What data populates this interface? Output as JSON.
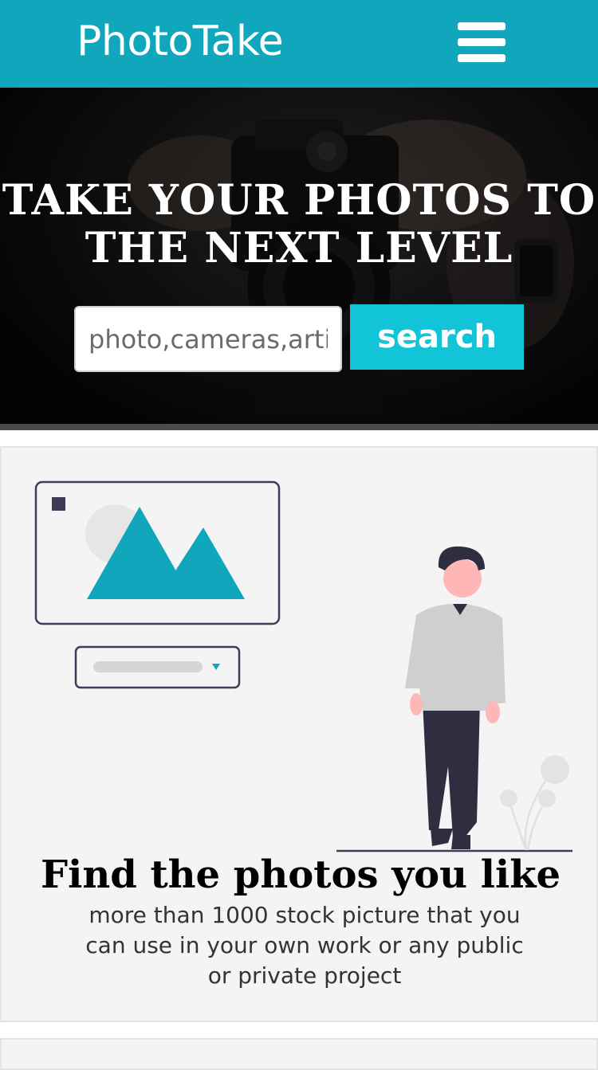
{
  "header": {
    "brand": "PhotoTake",
    "menu_icon": "hamburger-menu-icon",
    "background_color": "#10a7bd"
  },
  "hero": {
    "title": "TAKE YOUR PHOTOS TO THE NEXT LEVEL",
    "search_placeholder": "photo,cameras,arti",
    "search_button_label": "search",
    "background_image": "camera-photo",
    "button_color": "#12c4d8"
  },
  "feature": {
    "illustration": "person-with-image-frame-illustration",
    "title": "Find the photos you like",
    "description": "more than 1000 stock picture that you can use in your own work or any public or private project",
    "accent_color": "#10a7bd"
  }
}
